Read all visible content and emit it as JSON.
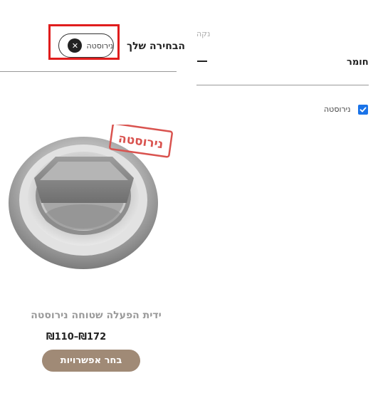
{
  "filters_bar": {
    "title": "הבחירה שלך",
    "chip_label": "נירוסטה",
    "chip_remove_glyph": "✕"
  },
  "filter_panel": {
    "clear_label": "נקה",
    "section_title": "חומר",
    "collapse_glyph": "—",
    "option_label": "נירוסטה",
    "option_checked": true
  },
  "product": {
    "stamp_text": "נירוסטה",
    "name": "ידית הפעלה שטוחה נירוסטה",
    "price": "₪110–₪172",
    "button_label": "בחר אפשרויות"
  },
  "colors": {
    "highlight": "#e01d1d",
    "button_bg": "#a08a76",
    "checkbox": "#1a73e8"
  }
}
